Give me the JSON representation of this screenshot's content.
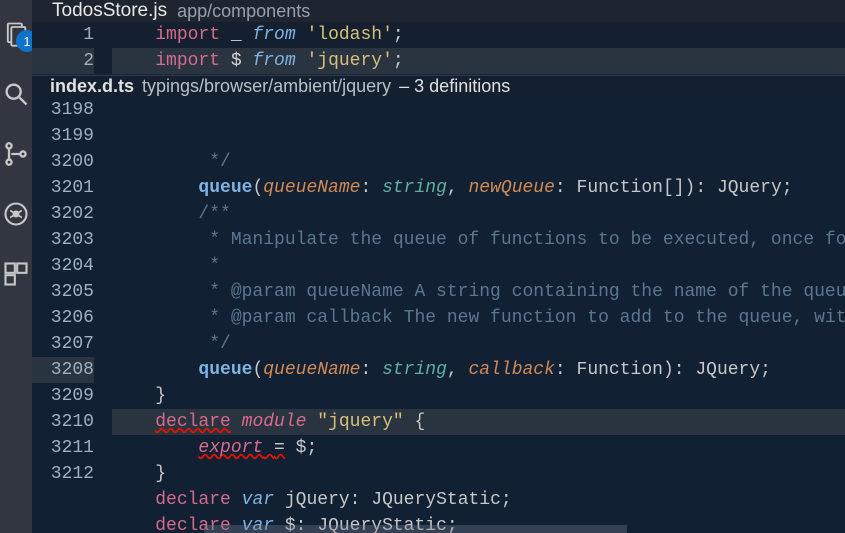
{
  "activity": {
    "badge": "1"
  },
  "topEditor": {
    "filename": "TodosStore.js",
    "path": "app/components",
    "lines": [
      {
        "num": "1",
        "tokens": [
          {
            "t": "import",
            "c": "kw-import"
          },
          {
            "t": " _ ",
            "c": "ident"
          },
          {
            "t": "from",
            "c": "kw-from"
          },
          {
            "t": " ",
            "c": ""
          },
          {
            "t": "'lodash'",
            "c": "str"
          },
          {
            "t": ";",
            "c": "semi"
          }
        ],
        "hl": false
      },
      {
        "num": "2",
        "tokens": [
          {
            "t": "import",
            "c": "kw-import"
          },
          {
            "t": " $ ",
            "c": "ident"
          },
          {
            "t": "from",
            "c": "kw-from"
          },
          {
            "t": " ",
            "c": ""
          },
          {
            "t": "'jquery'",
            "c": "str"
          },
          {
            "t": ";",
            "c": "semi"
          }
        ],
        "hl": true
      }
    ]
  },
  "peek": {
    "filename": "index.d.ts",
    "path": "typings/browser/ambient/jquery",
    "dash": " – ",
    "count": "3 definitions",
    "lines": [
      {
        "num": "3198",
        "tokens": [
          {
            "t": "         */",
            "c": "cmt"
          }
        ]
      },
      {
        "num": "3199",
        "tokens": [
          {
            "t": "        ",
            "c": ""
          },
          {
            "t": "queue",
            "c": "fn"
          },
          {
            "t": "(",
            "c": "brace"
          },
          {
            "t": "queueName",
            "c": "param"
          },
          {
            "t": ": ",
            "c": "brace"
          },
          {
            "t": "string",
            "c": "type"
          },
          {
            "t": ", ",
            "c": "brace"
          },
          {
            "t": "newQueue",
            "c": "param"
          },
          {
            "t": ": Function[]): JQuery;",
            "c": "brace"
          }
        ]
      },
      {
        "num": "3200",
        "tokens": [
          {
            "t": "        /**",
            "c": "cmt"
          }
        ]
      },
      {
        "num": "3201",
        "tokens": [
          {
            "t": "         * Manipulate the queue of functions to be executed, once fo",
            "c": "cmt"
          }
        ]
      },
      {
        "num": "3202",
        "tokens": [
          {
            "t": "         *",
            "c": "cmt"
          }
        ]
      },
      {
        "num": "3203",
        "tokens": [
          {
            "t": "         * @param queueName A string containing the name of the queu",
            "c": "cmt"
          }
        ]
      },
      {
        "num": "3204",
        "tokens": [
          {
            "t": "         * @param callback The new function to add to the queue, wit",
            "c": "cmt"
          }
        ]
      },
      {
        "num": "3205",
        "tokens": [
          {
            "t": "         */",
            "c": "cmt"
          }
        ]
      },
      {
        "num": "3206",
        "tokens": [
          {
            "t": "        ",
            "c": ""
          },
          {
            "t": "queue",
            "c": "fn"
          },
          {
            "t": "(",
            "c": "brace"
          },
          {
            "t": "queueName",
            "c": "param"
          },
          {
            "t": ": ",
            "c": "brace"
          },
          {
            "t": "string",
            "c": "type"
          },
          {
            "t": ", ",
            "c": "brace"
          },
          {
            "t": "callback",
            "c": "param"
          },
          {
            "t": ": Function): JQuery;",
            "c": "brace"
          }
        ]
      },
      {
        "num": "3207",
        "tokens": [
          {
            "t": "    }",
            "c": "brace"
          }
        ]
      },
      {
        "num": "3208",
        "hl": true,
        "tokens": [
          {
            "t": "    ",
            "c": ""
          },
          {
            "t": "declare",
            "c": "kw-dec",
            "sq": true
          },
          {
            "t": " ",
            "c": ""
          },
          {
            "t": "module",
            "c": "kw-mod"
          },
          {
            "t": " ",
            "c": ""
          },
          {
            "t": "\"jquery\"",
            "c": "str"
          },
          {
            "t": " {",
            "c": "brace"
          }
        ]
      },
      {
        "num": "3209",
        "tokens": [
          {
            "t": "        ",
            "c": ""
          },
          {
            "t": "export",
            "c": "kw-export",
            "sq": true
          },
          {
            "t": " ",
            "c": "",
            "sq": true
          },
          {
            "t": "=",
            "c": "brace",
            "sq": true
          },
          {
            "t": " $;",
            "c": "brace"
          }
        ]
      },
      {
        "num": "3210",
        "tokens": [
          {
            "t": "    }",
            "c": "brace"
          }
        ]
      },
      {
        "num": "3211",
        "tokens": [
          {
            "t": "    ",
            "c": ""
          },
          {
            "t": "declare",
            "c": "kw-dec"
          },
          {
            "t": " ",
            "c": ""
          },
          {
            "t": "var",
            "c": "kw-var"
          },
          {
            "t": " jQuery: JQueryStatic;",
            "c": "brace"
          }
        ]
      },
      {
        "num": "3212",
        "tokens": [
          {
            "t": "    ",
            "c": ""
          },
          {
            "t": "declare",
            "c": "kw-dec"
          },
          {
            "t": " ",
            "c": ""
          },
          {
            "t": "var",
            "c": "kw-var"
          },
          {
            "t": " $: JQueryStatic;",
            "c": "brace"
          }
        ]
      }
    ]
  }
}
